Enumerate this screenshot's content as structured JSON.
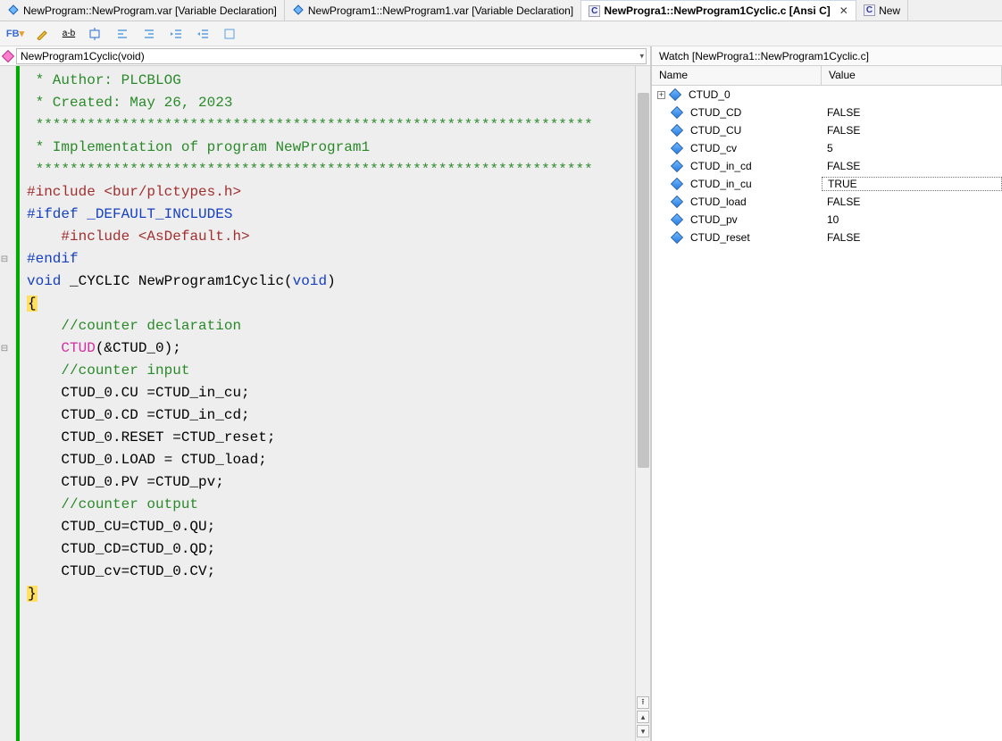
{
  "tabs": [
    {
      "label": "NewProgram::NewProgram.var [Variable Declaration]",
      "icon": "var-icon",
      "active": false
    },
    {
      "label": "NewProgram1::NewProgram1.var [Variable Declaration]",
      "icon": "var-icon",
      "active": false
    },
    {
      "label": "NewProgra1::NewProgram1Cyclic.c [Ansi C]",
      "icon": "c-icon",
      "active": true,
      "closeable": true
    },
    {
      "label": "New",
      "icon": "c-icon",
      "active": false
    }
  ],
  "toolbar": {
    "icons": [
      "fb",
      "save",
      "bookmark-toggle",
      "format",
      "indent-left",
      "indent-right",
      "outdent",
      "indent",
      "block"
    ]
  },
  "nav": {
    "func_signature": "NewProgram1Cyclic(void)"
  },
  "code": {
    "lines": [
      {
        "t": " * Author: PLCBLOG",
        "cls": "c-comment"
      },
      {
        "t": " * Created: May 26, 2023",
        "cls": "c-comment"
      },
      {
        "t": " *****************************************************************",
        "cls": "c-comment"
      },
      {
        "t": " * Implementation of program NewProgram1",
        "cls": "c-comment"
      },
      {
        "t": " *****************************************************************",
        "cls": "c-comment"
      },
      {
        "t": "",
        "cls": ""
      },
      {
        "raw": "<span class=\"c-include\">#include</span> <span class=\"c-include\">&lt;bur/plctypes.h&gt;</span>"
      },
      {
        "t": "",
        "cls": ""
      },
      {
        "raw": "<span class=\"c-pp\">#ifdef</span> <span class=\"c-pp\">_DEFAULT_INCLUDES</span>",
        "fold": "minus"
      },
      {
        "raw": "    <span class=\"c-include\">#include</span> <span class=\"c-include\">&lt;AsDefault.h&gt;</span>"
      },
      {
        "raw": "<span class=\"c-pp\">#endif</span>"
      },
      {
        "t": "",
        "cls": ""
      },
      {
        "raw": "<span class=\"c-kw\">void</span> _CYCLIC NewProgram1Cyclic(<span class=\"c-kw\">void</span>)",
        "fold": "minus"
      },
      {
        "raw": "<span class=\"c-brace\">{</span>"
      },
      {
        "raw": "    <span class=\"c-comment\">//counter declaration</span>"
      },
      {
        "raw": "    <span class=\"c-func\">CTUD</span>(&amp;CTUD_0);"
      },
      {
        "t": "",
        "cls": ""
      },
      {
        "raw": "    <span class=\"c-comment\">//counter input</span>"
      },
      {
        "raw": "    CTUD_0.CU =CTUD_in_cu;"
      },
      {
        "raw": "    CTUD_0.CD =CTUD_in_cd;"
      },
      {
        "raw": "    CTUD_0.RESET =CTUD_reset;"
      },
      {
        "raw": "    CTUD_0.LOAD = CTUD_load;"
      },
      {
        "raw": "    CTUD_0.PV =CTUD_pv;"
      },
      {
        "raw": "    <span class=\"c-comment\">//counter output</span>"
      },
      {
        "raw": "    CTUD_CU=CTUD_0.QU;"
      },
      {
        "raw": "    CTUD_CD=CTUD_0.QD;"
      },
      {
        "raw": "    CTUD_cv=CTUD_0.CV;"
      },
      {
        "t": "",
        "cls": ""
      },
      {
        "raw": "<span class=\"c-brace\">}</span>"
      }
    ]
  },
  "watch": {
    "title": "Watch [NewProgra1::NewProgram1Cyclic.c]",
    "columns": {
      "name": "Name",
      "value": "Value"
    },
    "rows": [
      {
        "name": "CTUD_0",
        "value": "",
        "expandable": true
      },
      {
        "name": "CTUD_CD",
        "value": "FALSE"
      },
      {
        "name": "CTUD_CU",
        "value": "FALSE"
      },
      {
        "name": "CTUD_cv",
        "value": "5"
      },
      {
        "name": "CTUD_in_cd",
        "value": "FALSE"
      },
      {
        "name": "CTUD_in_cu",
        "value": "TRUE",
        "selected": true
      },
      {
        "name": "CTUD_load",
        "value": "FALSE"
      },
      {
        "name": "CTUD_pv",
        "value": "10"
      },
      {
        "name": "CTUD_reset",
        "value": "FALSE"
      }
    ]
  }
}
